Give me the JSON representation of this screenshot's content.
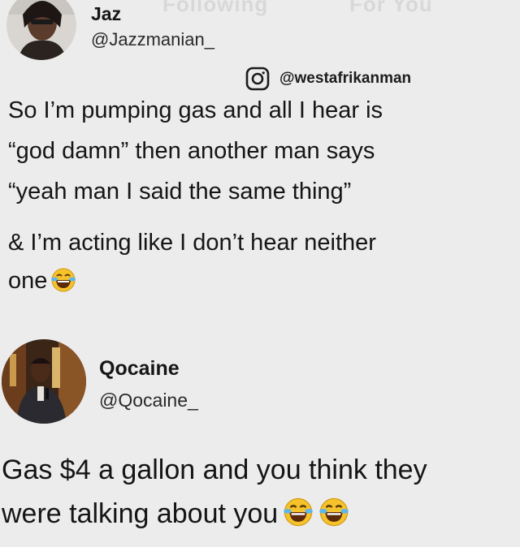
{
  "header": {
    "tab_following": "Following",
    "tab_for_you": "For You"
  },
  "post1": {
    "author_name": "Jaz",
    "author_handle": "@Jazzmanian_",
    "avatar": "profile-photo-jaz",
    "credit": {
      "icon": "instagram-icon",
      "handle": "@westafrikanman"
    },
    "lines": [
      "So I’m pumping gas and all I hear is",
      "“god damn” then another man says",
      "“yeah man I said the same thing”",
      "& I’m acting like I don’t hear neither",
      "one"
    ],
    "emoji": "face-with-tears-of-joy-icon"
  },
  "post2": {
    "author_name": "Qocaine",
    "author_handle": "@Qocaine_",
    "avatar": "profile-photo-qocaine",
    "lines": [
      "Gas $4 a gallon and you think they",
      "were talking about you"
    ],
    "emoji": "face-with-tears-of-joy-icon"
  }
}
